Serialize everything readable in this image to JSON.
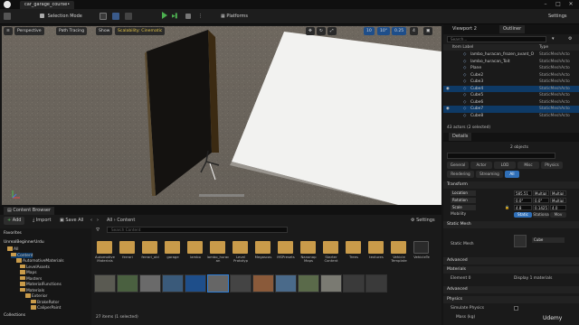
{
  "title_bar": {
    "tab": "car_garage_course•"
  },
  "toolbar": {
    "mode": "Selection Mode",
    "platforms": "Platforms",
    "settings": "Settings"
  },
  "viewport": {
    "buttons": [
      "Perspective",
      "Path Tracing",
      "Show",
      "Scalability: Cinematic"
    ],
    "snap_values": [
      "10",
      "10°",
      "0.25",
      "4"
    ]
  },
  "right_panel": {
    "tabs": [
      "Viewport 2",
      "Outliner"
    ],
    "search_placeholder": "Search...",
    "columns": {
      "label": "Item Label",
      "type": "Type"
    },
    "outliner_rows": [
      {
        "label": "lambo_huracan_frozen_avant_O",
        "type": "StaticMeshActo",
        "selected": false
      },
      {
        "label": "lambo_huracan_Toit",
        "type": "StaticMeshActo",
        "selected": false
      },
      {
        "label": "Plane",
        "type": "StaticMeshActo",
        "selected": false
      },
      {
        "label": "Cube2",
        "type": "StaticMeshActo",
        "selected": false
      },
      {
        "label": "Cube3",
        "type": "StaticMeshActo",
        "selected": false
      },
      {
        "label": "Cube4",
        "type": "StaticMeshActo",
        "selected": true
      },
      {
        "label": "Cube5",
        "type": "StaticMeshActo",
        "selected": false
      },
      {
        "label": "Cube6",
        "type": "StaticMeshActo",
        "selected": false
      },
      {
        "label": "Cube7",
        "type": "StaticMeshActo",
        "selected": true
      },
      {
        "label": "Cube8",
        "type": "StaticMeshActo",
        "selected": false
      }
    ],
    "actor_count": "43 actors (2 selected)",
    "details": {
      "tab": "Details",
      "objects": "2 objects",
      "filter_tabs_row1": [
        "General",
        "Actor",
        "LOD",
        "Misc",
        "Physics"
      ],
      "filter_tabs_row2": [
        "Rendering",
        "Streaming",
        "All"
      ],
      "sections": {
        "transform": "Transform",
        "static_mesh": "Static Mesh",
        "advanced": "Advanced",
        "materials": "Materials",
        "advanced2": "Advanced",
        "physics": "Physics"
      },
      "transform": {
        "location_label": "Location",
        "location": [
          "585.51",
          "Multipl",
          "Multipl"
        ],
        "rotation_label": "Rotation",
        "rotation": [
          "0.0°",
          "0.0°",
          "Multipl"
        ],
        "scale_label": "Scale",
        "scale": [
          "4.8",
          "0.1425",
          "4.0"
        ],
        "mobility_label": "Mobility",
        "mobility": [
          "Static",
          "Stationa",
          "Mov"
        ]
      },
      "static_mesh_label": "Static Mesh",
      "static_mesh_value": "Cube",
      "element_label": "Element 0",
      "materials_value": "Display 1 materials",
      "simulate_label": "Simulate Physics",
      "mass_label": "Mass (kg)"
    }
  },
  "content_browser": {
    "tab": "Content Browser",
    "add": "Add",
    "import": "Import",
    "save_all": "Save All",
    "path": [
      "All",
      "Content"
    ],
    "settings": "Settings",
    "search_placeholder": "Search Content",
    "favorites": "Favorites",
    "project": "UnrealBeginnerUrdu",
    "tree": [
      "All",
      "Content",
      "AutomotiveMaterials",
      "LevelAssets",
      "Maps",
      "Masters",
      "MaterialFunctions",
      "Materials",
      "Exterior",
      "BrakeRotor",
      "CaliperPaint"
    ],
    "collections": "Collections",
    "folders_row1": [
      "Automotive Materials",
      "ferrari",
      "ferrari_old",
      "garage",
      "lambo",
      "lambo_huracan",
      "Level Prototyp",
      "Megascas",
      "MSPresets",
      "Nanonap Maps",
      "Starter Content",
      "Trees",
      "textures",
      "Vehicle Template",
      "VehicleTe"
    ],
    "assets_row2": [
      "",
      "",
      "",
      "",
      "",
      "",
      "",
      "",
      "",
      "",
      "",
      "",
      ""
    ],
    "status": "27 items (1 selected)"
  },
  "watermark": "Udemy"
}
